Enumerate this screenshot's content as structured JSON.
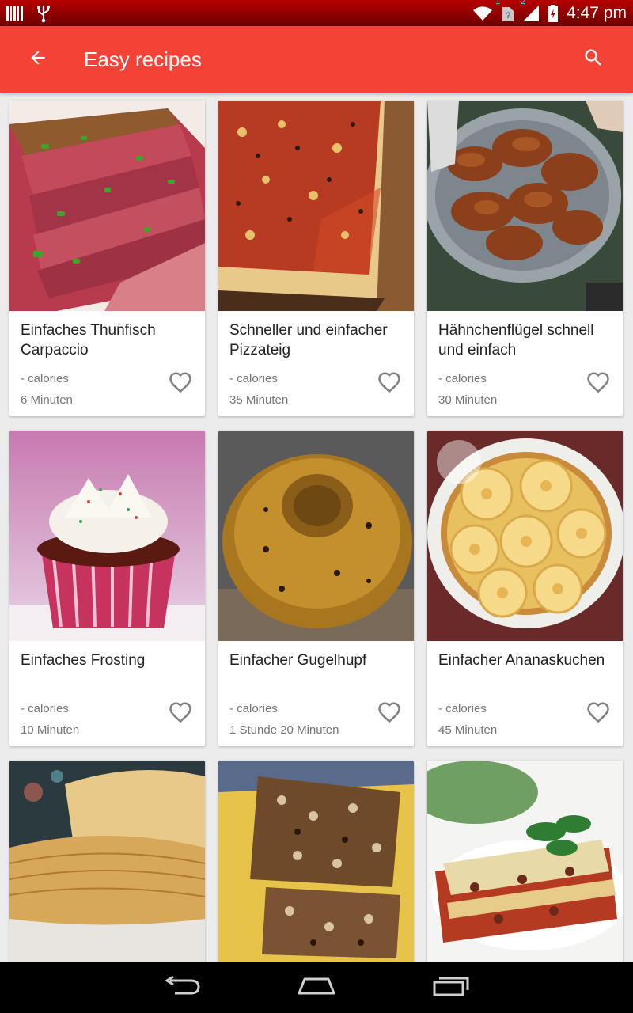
{
  "status_bar": {
    "time": "4:47 pm",
    "icons": [
      "barcode-icon",
      "usb-icon",
      "wifi-icon",
      "sim-1-icon",
      "signal-icon",
      "battery-charging-icon"
    ],
    "sim1_badge": "1",
    "sim2_badge": "2"
  },
  "app_bar": {
    "title": "Easy recipes",
    "back_icon": "arrow-left-icon",
    "search_icon": "search-icon",
    "color": "#f44336"
  },
  "recipes": [
    {
      "name": "Einfaches Thunfisch Carpaccio",
      "calories": "- calories",
      "time": "6 Minuten",
      "image": "tuna-carpaccio"
    },
    {
      "name": "Schneller und einfacher Pizzateig",
      "calories": "- calories",
      "time": "35 Minuten",
      "image": "pizza"
    },
    {
      "name": "Hähnchenflügel schnell und einfach",
      "calories": "- calories",
      "time": "30 Minuten",
      "image": "chicken-wings"
    },
    {
      "name": "Einfaches Frosting",
      "calories": "- calories",
      "time": "10 Minuten",
      "image": "cupcake"
    },
    {
      "name": "Einfacher Gugelhupf",
      "calories": "- calories",
      "time": "1 Stunde 20 Minuten",
      "image": "gugelhupf"
    },
    {
      "name": "Einfacher Ananaskuchen",
      "calories": "- calories",
      "time": "45 Minuten",
      "image": "pineapple-cake"
    },
    {
      "name": "",
      "calories": "",
      "time": "",
      "image": "puff-pastry"
    },
    {
      "name": "",
      "calories": "",
      "time": "",
      "image": "oat-bars"
    },
    {
      "name": "",
      "calories": "",
      "time": "",
      "image": "lasagna"
    }
  ],
  "nav_bar": {
    "back_icon": "nav-back-icon",
    "home_icon": "nav-home-icon",
    "recents_icon": "nav-recents-icon"
  }
}
